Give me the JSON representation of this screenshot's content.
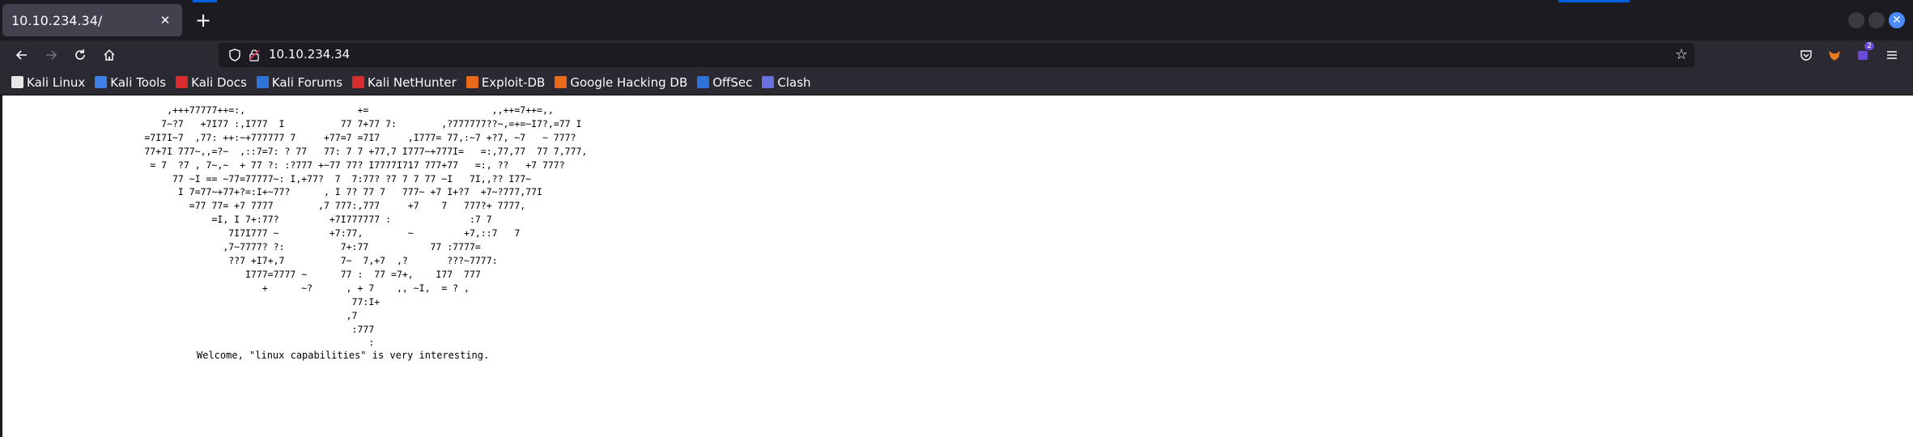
{
  "browser": {
    "tab": {
      "title": "10.10.234.34/",
      "close_symbol": "✕"
    },
    "new_tab_symbol": "+",
    "url": "10.10.234.34",
    "extension_badge": "2"
  },
  "bookmarks": [
    {
      "label": "Kali Linux",
      "icon": "kali-dragon-icon",
      "color": "#e8e8e8"
    },
    {
      "label": "Kali Tools",
      "icon": "kali-tools-icon",
      "color": "#3f7fe8"
    },
    {
      "label": "Kali Docs",
      "icon": "kali-docs-icon",
      "color": "#d92d2d"
    },
    {
      "label": "Kali Forums",
      "icon": "kali-forums-icon",
      "color": "#2f73d9"
    },
    {
      "label": "Kali NetHunter",
      "icon": "kali-nethunter-icon",
      "color": "#d92d2d"
    },
    {
      "label": "Exploit-DB",
      "icon": "exploit-db-icon",
      "color": "#e86a1a"
    },
    {
      "label": "Google Hacking DB",
      "icon": "ghdb-icon",
      "color": "#e86a1a"
    },
    {
      "label": "OffSec",
      "icon": "offsec-icon",
      "color": "#2f73d9"
    },
    {
      "label": "Clash",
      "icon": "clash-icon",
      "color": "#6a72e0"
    }
  ],
  "page": {
    "ascii_art": "            ,+++77777++=:,                    +=                      ,,++=7++=,,\n           7~?7   +7I77 :,I777  I          77 7+77 7:        ,?777777??~,=+=~I7?,=77 I\n        =7I7I~7  ,77: ++:~+777777 7     +77=7 =7I7     ,I777= 77,:~7 +?7, ~7   ~ 777?\n        77+7I 777~,,=?~  ,::7=7: ? 77   77: 7 7 +77,7 I777~+777I=   =:,77,77  77 7,777,\n         = 7  ?7 , 7~,~  + 77 ?: :?777 +~77 77? I7777I717 777+77   =:, ??   +7 777?\n             77 ~I == ~77=77777~: I,+77?  7  7:77? ?7 7 7 77 ~I   7I,,?? I77~\n              I 7=77~+77+?=:I+~77?      , I 7? 77 7   777~ +7 I+?7  +7~?777,77I\n                =77 77= +7 7777        ,7 777:,777     +7    7   777?+ 7777,\n                    =I, I 7+:77?         +7I777777 :              :7 7\n                       7I7I777 ~         +7:77,        ~         +7,::7   7\n                      ,7~7777? ?:          7+:77           77 :7777=\n                       ??7 +I7+,7          7~  7,+7  ,?       ???~7777:\n                          I777=7777 ~      77 :  77 =7+,    I77  777\n                             +      ~?      , + 7    ,, ~I,  = ? ,\n                                             77:I+\n                                            ,7\n                                             :777\n                                                :",
    "welcome_text": "Welcome, \"linux capabilities\" is very interesting."
  }
}
